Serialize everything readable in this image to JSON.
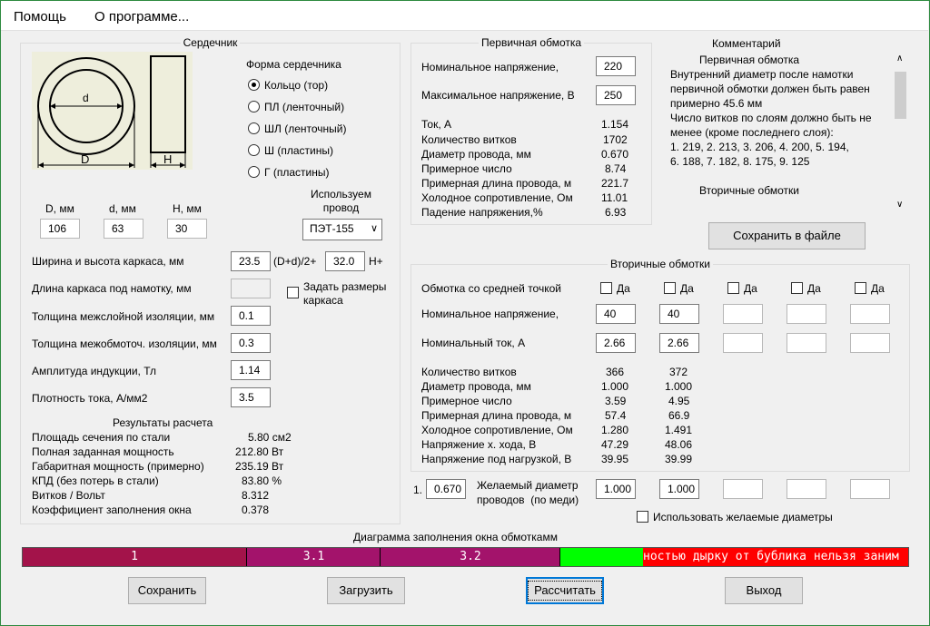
{
  "menu": [
    "Помощь",
    "О программе..."
  ],
  "core": {
    "title": "Сердечник",
    "shape_label": "Форма сердечника",
    "shapes": [
      "Кольцо  (тор)",
      "ПЛ  (ленточный)",
      "ШЛ  (ленточный)",
      "Ш  (пластины)",
      "Г  (пластины)"
    ],
    "drawing_labels": {
      "d": "d",
      "D": "D",
      "H": "H"
    },
    "dims": [
      {
        "label": "D, мм",
        "value": "106"
      },
      {
        "label": "d, мм",
        "value": "63"
      },
      {
        "label": "H, мм",
        "value": "30"
      }
    ],
    "wire_label": "Используем\nпровод",
    "wire_value": "ПЭТ-155",
    "frame_label": "Ширина и высота каркаса, мм",
    "frame_w": "23.5",
    "frame_mid": "(D+d)/2+",
    "frame_h": "32.0",
    "frame_suffix": "H+",
    "winding_len_label": "Длина каркаса под намотку, мм",
    "set_frame_label": "Задать размеры\nкаркаса",
    "params": [
      {
        "label": "Толщина межслойной изоляции, мм",
        "value": "0.1"
      },
      {
        "label": "Толщина межобмоточ. изоляции, мм",
        "value": "0.3"
      },
      {
        "label": "Амплитуда индукции, Тл",
        "value": "1.14"
      },
      {
        "label": "Плотность тока, А/мм2",
        "value": "3.5"
      }
    ],
    "results_title": "Результаты расчета",
    "results": [
      {
        "label": "Площадь сечения по стали",
        "value": "5.80 см2"
      },
      {
        "label": "Полная заданная мощность",
        "value": "212.80 Вт"
      },
      {
        "label": "Габаритная мощность (примерно)",
        "value": "235.19 Вт"
      },
      {
        "label": "КПД (без потерь в стали)",
        "value": "83.80 %"
      },
      {
        "label": "Витков / Вольт",
        "value": "8.312"
      },
      {
        "label": "Коэффициент заполнения окна",
        "value": "0.378"
      }
    ]
  },
  "primary": {
    "title": "Первичная обмотка",
    "nominal_label": "Номинальное напряжение,",
    "nominal_value": "220",
    "max_label": "Максимальное напряжение, В",
    "max_value": "250",
    "rows": [
      {
        "label": "Ток, А",
        "value": "1.154"
      },
      {
        "label": "Количество витков",
        "value": "1702"
      },
      {
        "label": "Диаметр провода, мм",
        "value": "0.670"
      },
      {
        "label": "Примерное число",
        "value": "8.74"
      },
      {
        "label": "Примерная длина провода, м",
        "value": "221.7"
      },
      {
        "label": "Холодное сопротивление, Ом",
        "value": "11.01"
      },
      {
        "label": "Падение напряжения,%",
        "value": "6.93"
      }
    ]
  },
  "comment": {
    "title": "Комментарий",
    "lines": [
      "Первичная обмотка",
      "Внутренний диаметр после намотки",
      "первичной обмотки должен быть равен",
      "примерно 45.6 мм",
      "Число витков по слоям должно быть не",
      "менее (кроме последнего слоя):",
      "1. 219,  2. 213,  3. 206,  4. 200,  5. 194,",
      "6. 188,  7. 182,  8. 175,  9. 125",
      "",
      "Вторичные обмотки"
    ],
    "save_button": "Сохранить в файле"
  },
  "secondary": {
    "title": "Вторичные обмотки",
    "center_tap_label": "Обмотка со средней точкой",
    "yes_label": "Да",
    "nominal_v_label": "Номинальное напряжение,",
    "nominal_i_label": "Номинальный ток, А",
    "v_values": [
      "40",
      "40",
      "",
      "",
      ""
    ],
    "i_values": [
      "2.66",
      "2.66",
      "",
      "",
      ""
    ],
    "row_labels": [
      "Количество витков",
      "Диаметр провода, мм",
      "Примерное число",
      "Примерная длина провода, м",
      "Холодное сопротивление, Ом",
      "Напряжение х. хода, В",
      "Напряжение под нагрузкой, В"
    ],
    "col1": [
      "366",
      "1.000",
      "3.59",
      "57.4",
      "1.280",
      "47.29",
      "39.95"
    ],
    "col2": [
      "372",
      "1.000",
      "4.95",
      "66.9",
      "1.491",
      "48.06",
      "39.99"
    ],
    "desired_prefix": "1.",
    "desired_first": "0.670",
    "desired_label": "Желаемый диаметр\nпроводов  (по меди)",
    "desired_values": [
      "1.000",
      "1.000",
      "",
      "",
      ""
    ],
    "use_desired_label": "Использовать желаемые диаметры"
  },
  "diagram": {
    "title": "Диаграмма заполнения окна обмоткамм",
    "segments": [
      {
        "label": "1",
        "color": "#a3134a"
      },
      {
        "label": "3.1",
        "color": "#a3136b"
      },
      {
        "label": "3.2",
        "color": "#a3136b"
      },
      {
        "label": "",
        "color": "#00ff00"
      },
      {
        "label": "ностью дырку от бублика нельзя заним",
        "color": "#ff0000"
      }
    ]
  },
  "buttons": {
    "save": "Сохранить",
    "load": "Загрузить",
    "calc": "Рассчитать",
    "exit": "Выход"
  },
  "colors": {
    "window_border": "#2d8a3f",
    "focus": "#0078d7"
  }
}
